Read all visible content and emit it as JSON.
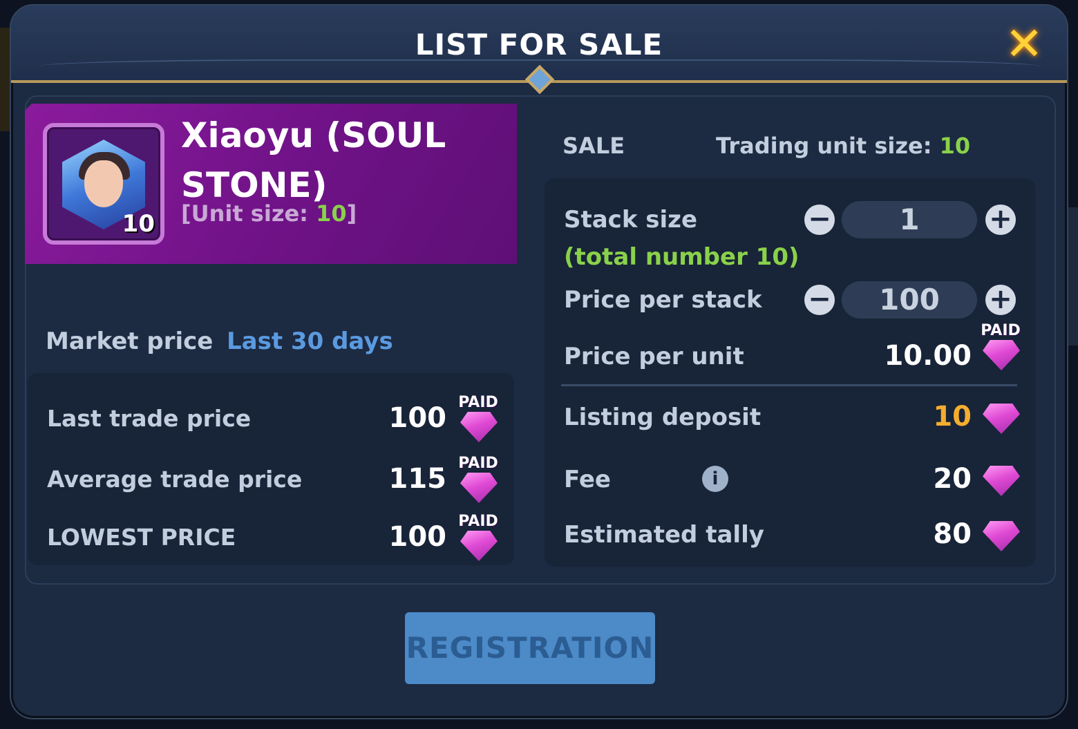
{
  "modal": {
    "title": "LIST FOR SALE"
  },
  "item": {
    "name": "Xiaoyu (SOUL STONE)",
    "count": "10",
    "unit_size_prefix": "[Unit size: ",
    "unit_size_value": "10",
    "unit_size_suffix": "]"
  },
  "market": {
    "label": "Market price",
    "period": "Last 30 days",
    "rows": [
      {
        "label": "Last trade price",
        "value": "100",
        "badge": "PAID"
      },
      {
        "label": "Average trade price",
        "value": "115",
        "badge": "PAID"
      },
      {
        "label": "LOWEST PRICE",
        "value": "100",
        "badge": "PAID"
      }
    ]
  },
  "sale": {
    "label": "SALE",
    "trading_unit_label": "Trading unit size: ",
    "trading_unit_value": "10",
    "stack_size_label": "Stack size",
    "stack_size_sub": "(total number 10)",
    "stack_size_value": "1",
    "price_per_stack_label": "Price per stack",
    "price_per_stack_value": "100",
    "price_per_unit_label": "Price per unit",
    "price_per_unit_value": "10.00",
    "price_per_unit_badge": "PAID",
    "listing_deposit_label": "Listing deposit",
    "listing_deposit_value": "10",
    "fee_label": "Fee",
    "fee_value": "20",
    "estimated_tally_label": "Estimated tally",
    "estimated_tally_value": "80"
  },
  "actions": {
    "register_label": "REGISTRATION"
  },
  "colors": {
    "accent_green": "#8ad14a",
    "accent_orange": "#f4ae2e",
    "link_blue": "#5b9ae0",
    "gem_pink": "#e04ad4",
    "close_yellow": "#ffd23a"
  },
  "icons": [
    "close-icon",
    "minus-icon",
    "plus-icon",
    "info-icon",
    "gem-icon",
    "soul-stone-icon"
  ]
}
